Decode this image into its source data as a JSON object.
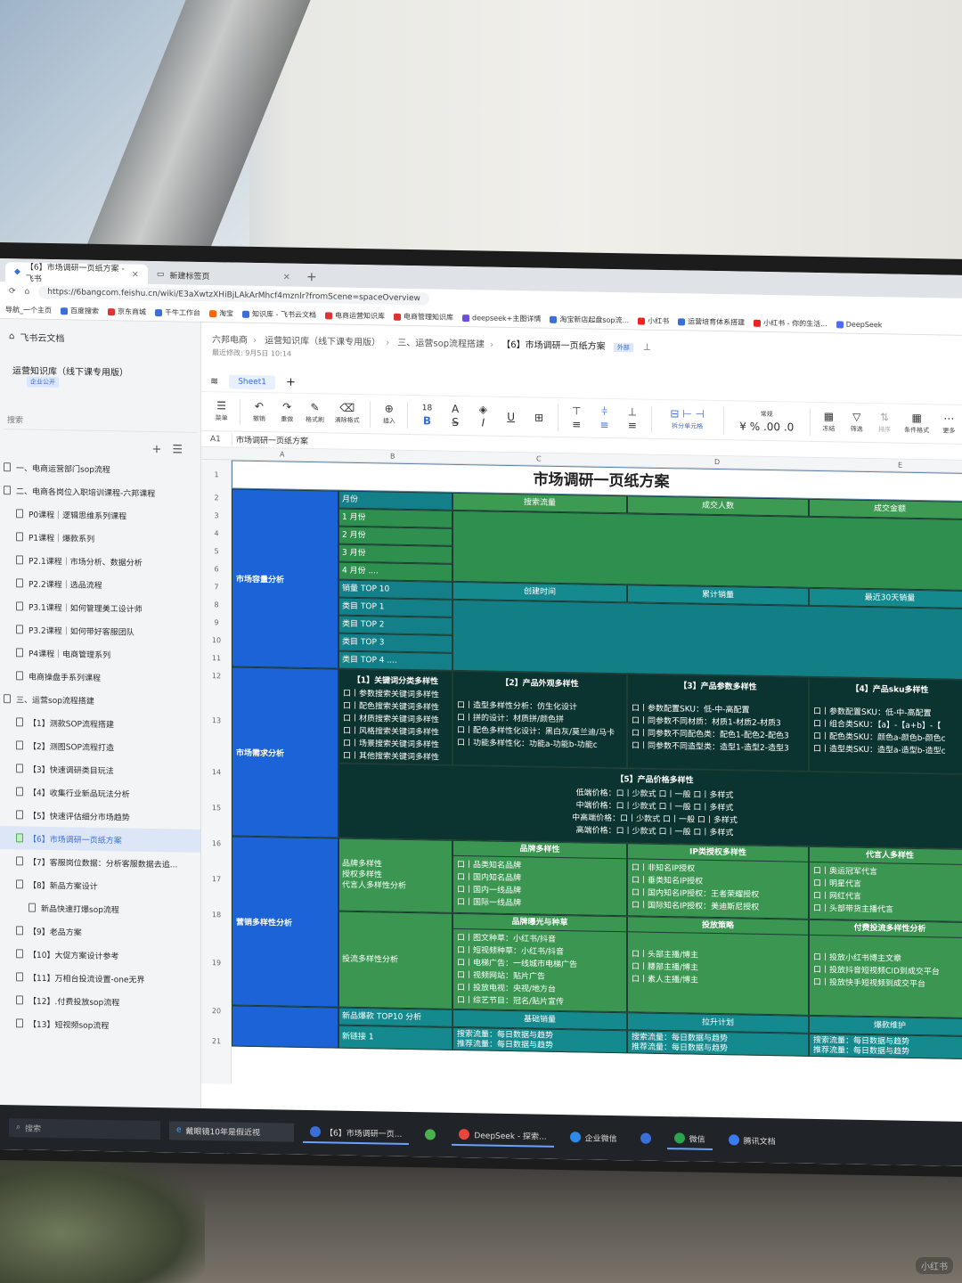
{
  "browser": {
    "tabs": [
      {
        "label": "【6】市场调研一页纸方案 - 飞书",
        "active": true
      },
      {
        "label": "新建标签页",
        "active": false
      }
    ],
    "url": "https://6bangcom.feishu.cn/wiki/E3aXwtzXHiBjLAkArMhcf4mznlr?fromScene=spaceOverview",
    "bookmarks": [
      "导航_一个主页",
      "百度搜索",
      "京东商城",
      "千牛工作台",
      "淘宝",
      "知识库 - 飞书云文档",
      "电商运营知识库",
      "电商管理知识库",
      "deepseek+主图详情",
      "淘宝新店起盘sop流...",
      "小红书",
      "运营培育体系搭建",
      "小红书 - 你的生活...",
      "DeepSeek"
    ]
  },
  "sidebar": {
    "brand": "飞书云文档",
    "kb_title": "运营知识库（线下课专用版）",
    "kb_badge": "企业公开",
    "search_placeholder": "搜索",
    "items": [
      "一、电商运营部门sop流程",
      "二、电商各岗位入职培训课程-六邦课程",
      "P0课程｜逻辑思维系列课程",
      "P1课程｜爆款系列",
      "P2.1课程｜市场分析、数据分析",
      "P2.2课程｜选品流程",
      "P3.1课程｜如何管理美工设计师",
      "P3.2课程｜如何带好客服团队",
      "P4课程｜电商管理系列",
      "电商操盘手系列课程",
      "三、运营sop流程搭建",
      "【1】测款SOP流程搭建",
      "【2】测图SOP流程打造",
      "【3】快速调研类目玩法",
      "【4】收集行业新品玩法分析",
      "【5】快速评估细分市场趋势",
      "【6】市场调研一页纸方案",
      "【7】客服岗位数据：分析客服数据去追...",
      "【8】新品方案设计",
      "新品快速打爆sop流程",
      "【9】老品方案",
      "【10】大促方案设计参考",
      "【11】万相台投流设置-one无界",
      "【12】.付费投放sop流程",
      "【13】短视频sop流程"
    ]
  },
  "doc": {
    "breadcrumb": [
      "六邦电商",
      "运营知识库（线下课专用版）",
      "三、运营sop流程搭建",
      "【6】市场调研一页纸方案"
    ],
    "tag": "外部",
    "modified": "最近修改: 9月5日 10:14",
    "sheet_tab": "Sheet1",
    "cell_ref": "A1",
    "formula": "市场调研一页纸方案"
  },
  "toolbar": {
    "menu": "菜单",
    "undo": "撤销",
    "redo": "重做",
    "format_painter": "格式刷",
    "clear_format": "清除格式",
    "insert": "插入",
    "font_size": "18",
    "merge": "拆分单元格",
    "number_format": "常规",
    "freeze": "冻结",
    "filter": "筛选",
    "sort": "排序",
    "cond_format": "条件格式",
    "more": "更多"
  },
  "sheet": {
    "columns": [
      "A",
      "B",
      "C",
      "D",
      "E"
    ],
    "rows": [
      "1",
      "2",
      "3",
      "4",
      "5",
      "6",
      "7",
      "8",
      "9",
      "10",
      "11",
      "12",
      "13",
      "14",
      "15",
      "16",
      "17",
      "18",
      "19",
      "20",
      "21"
    ],
    "title": "市场调研一页纸方案",
    "sec1": {
      "name": "市场容量分析",
      "month_label": "月份",
      "headers": [
        "搜索流量",
        "成交人数",
        "成交金额"
      ],
      "months": [
        "1 月份",
        "2 月份",
        "3 月份",
        "4 月份 ...."
      ],
      "top_label": "销量 TOP 10",
      "top_headers": [
        "创建时间",
        "累计销量",
        "最近30天销量"
      ],
      "tops": [
        "类目 TOP 1",
        "类目 TOP 2",
        "类目 TOP 3",
        "类目 TOP 4 ...."
      ]
    },
    "sec2": {
      "name": "市场需求分析",
      "headers": [
        "【1】关键词分类多样性",
        "【2】产品外观多样性",
        "【3】产品参数多样性",
        "【4】产品sku多样性"
      ],
      "col1": [
        "口丨参数搜索关键词多样性",
        "口丨配色搜索关键词多样性",
        "口丨材质搜索关键词多样性",
        "口丨风格搜索关键词多样性",
        "口丨场景搜索关键词多样性",
        "口丨其他搜索关键词多样性"
      ],
      "col2": [
        "口丨造型多样性分析：仿生化设计",
        "口丨拼的设计：材质拼/颜色拼",
        "口丨配色多样性化设计：黑白灰/莫兰迪/马卡",
        "口丨功能多样性化：功能a-功能b-功能c"
      ],
      "col3": [
        "口丨参数配置SKU：低-中-高配置",
        "口丨同参数不同材质：材质1-材质2-材质3",
        "口丨同参数不同配色类：配色1-配色2-配色3",
        "口丨同参数不同造型类：造型1-造型2-造型3"
      ],
      "col4": [
        "口丨参数配置SKU：低-中-高配置",
        "口丨组合类SKU：【a】-【a+b】-【",
        "口丨配色类SKU：颜色a-颜色b-颜色c",
        "口丨造型类SKU：造型a-造型b-造型c"
      ],
      "price_header": "【5】产品价格多样性",
      "prices": [
        "低端价格：口丨少款式 口丨一般  口丨多样式",
        "中端价格：口丨少款式 口丨一般  口丨多样式",
        "中高端价格：口丨少款式 口丨一般  口丨多样式",
        "高端价格：口丨少款式 口丨一般  口丨多样式"
      ]
    },
    "sec3": {
      "name": "营销多样性分析",
      "brand_label": [
        "品牌多样性",
        "授权多样性",
        "代言人多样性分析"
      ],
      "brand_hd": "品牌多样性",
      "brand_items": [
        "口丨品类知名品牌",
        "口丨国内知名品牌",
        "口丨国内一线品牌",
        "口丨国际一线品牌"
      ],
      "ip_hd": "IP类授权多样性",
      "ip_items": [
        "口丨非知名IP授权",
        "口丨垂类知名IP授权",
        "口丨国内知名IP授权：王者荣耀授权",
        "口丨国际知名IP授权：美迪斯尼授权"
      ],
      "spokes_hd": "代言人多样性",
      "spokes_items": [
        "口丨奥运冠军代言",
        "口丨明星代言",
        "口丨网红代言",
        "口丨头部带货主播代言"
      ],
      "invest_label": "投流多样性分析",
      "expose_hd": "品牌曝光与种草",
      "expose_items": [
        "口丨图文种草：小红书/抖音",
        "口丨短视频种草：小红书/抖音",
        "口丨电梯广告：一线城市电梯广告",
        "口丨视频网站：贴片广告",
        "口丨投放电视：央视/地方台",
        "口丨综艺节目：冠名/贴片宣传"
      ],
      "strategy_hd": "投放策略",
      "strategy_items": [
        "口丨头部主播/博主",
        "口丨腰部主播/博主",
        "口丨素人主播/博主"
      ],
      "paid_hd": "付费投流多样性分析",
      "paid_items": [
        "口丨投放小红书博主文章",
        "口丨投放抖音短视频CID到成交平台",
        "口丨投放快手短视频到成交平台"
      ],
      "top10_label": "新品爆款 TOP10 分析",
      "top10_headers": [
        "基础销量",
        "拉升计划",
        "爆款维护"
      ],
      "link_label": "新链接 1",
      "flow_lines": [
        "搜索流量：每日数据与趋势",
        "推荐流量：每日数据与趋势"
      ]
    }
  },
  "taskbar": {
    "search": "搜索",
    "news": "戴眼镜10年是假近视",
    "apps": [
      "【6】市场调研一页...",
      "DeepSeek - 探索...",
      "企业微信",
      "微信",
      "腾讯文档"
    ]
  },
  "watermark": "小红书"
}
